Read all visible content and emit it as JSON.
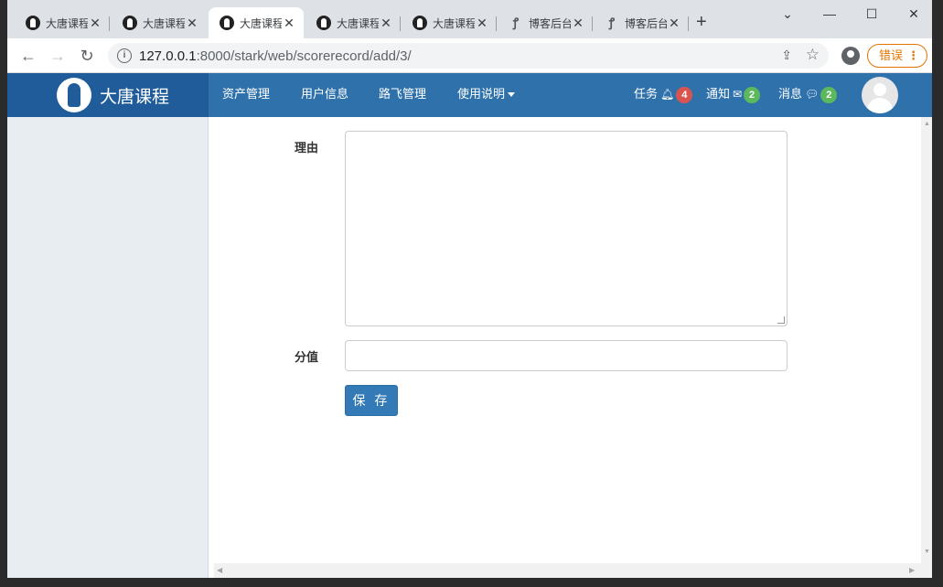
{
  "tabs": [
    {
      "title": "大唐课程",
      "favicon": "person-favicon",
      "active": false
    },
    {
      "title": "大唐课程",
      "favicon": "person-favicon",
      "active": false
    },
    {
      "title": "大唐课程",
      "favicon": "person-favicon",
      "active": true
    },
    {
      "title": "大唐课程",
      "favicon": "person-favicon",
      "active": false
    },
    {
      "title": "大唐课程",
      "favicon": "person-favicon",
      "active": false
    },
    {
      "title": "博客后台",
      "favicon": "blog-favicon",
      "active": false
    },
    {
      "title": "博客后台",
      "favicon": "blog-favicon",
      "active": false
    }
  ],
  "browser": {
    "url_host": "127.0.0.1",
    "url_rest": ":8000/stark/web/scorerecord/add/3/",
    "error_label": "错误"
  },
  "site": {
    "brand": "大唐课程",
    "menu": [
      "资产管理",
      "用户信息",
      "路飞管理",
      "使用说明"
    ],
    "notifications": [
      {
        "label": "任务",
        "icon": "bell-icon",
        "count": "4",
        "color": "#d9534f"
      },
      {
        "label": "通知",
        "icon": "envelope-icon",
        "count": "2",
        "color": "#5cb85c"
      },
      {
        "label": "消息",
        "icon": "comment-icon",
        "count": "2",
        "color": "#5cb85c"
      }
    ]
  },
  "form": {
    "reason_label": "理由",
    "reason_value": "",
    "score_label": "分值",
    "score_value": "",
    "save_label": "保 存"
  },
  "colors": {
    "navbar": "#2f72ab",
    "brand_bg": "#1f5c99",
    "primary_button": "#337ab7"
  }
}
